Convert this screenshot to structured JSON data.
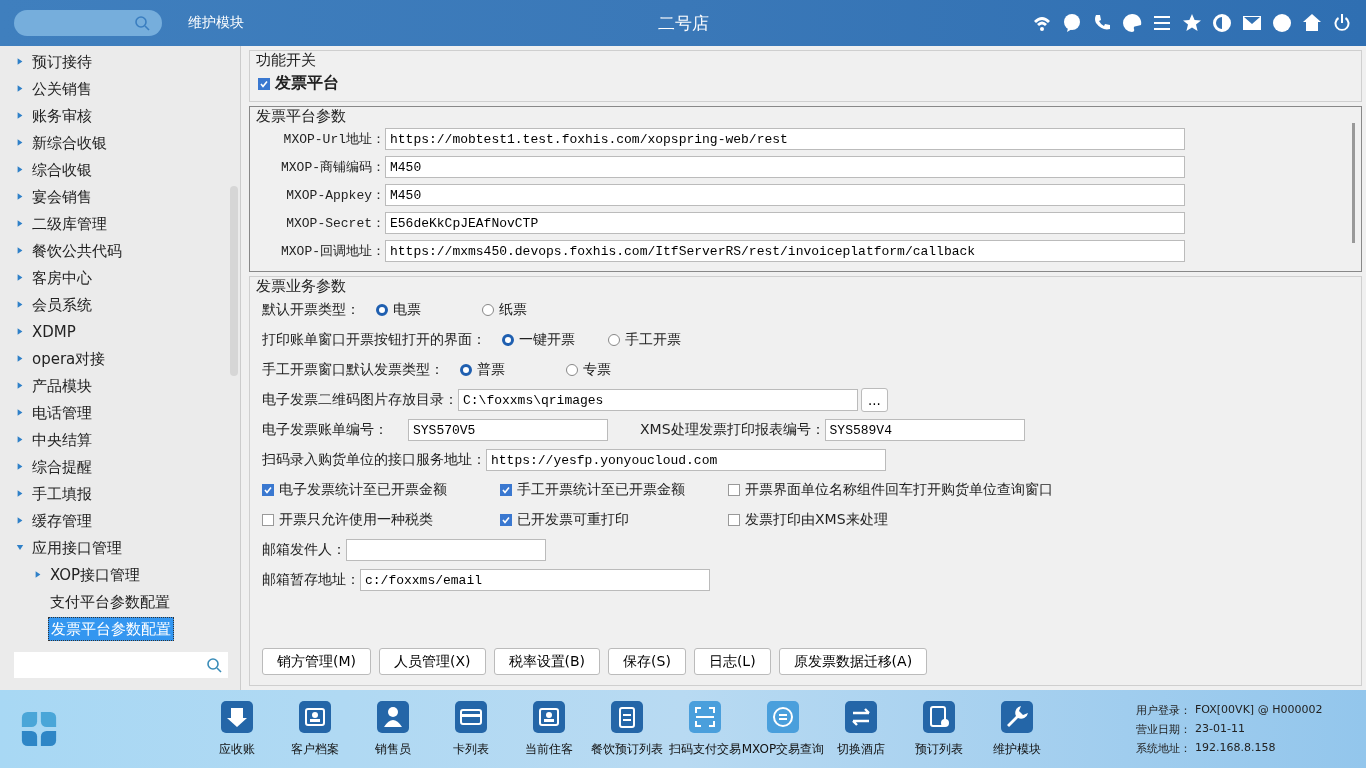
{
  "header": {
    "module": "维护模块",
    "title": "二号店"
  },
  "sidebar": {
    "items": [
      {
        "label": "预订接待",
        "kind": "folder",
        "expanded": false,
        "selected": false
      },
      {
        "label": "公关销售",
        "kind": "folder",
        "expanded": false,
        "selected": false
      },
      {
        "label": "账务审核",
        "kind": "folder",
        "expanded": false,
        "selected": false
      },
      {
        "label": "新综合收银",
        "kind": "folder",
        "expanded": false,
        "selected": false
      },
      {
        "label": "综合收银",
        "kind": "folder",
        "expanded": false,
        "selected": false
      },
      {
        "label": "宴会销售",
        "kind": "folder",
        "expanded": false,
        "selected": false
      },
      {
        "label": "二级库管理",
        "kind": "folder",
        "expanded": false,
        "selected": false
      },
      {
        "label": "餐饮公共代码",
        "kind": "folder",
        "expanded": false,
        "selected": false
      },
      {
        "label": "客房中心",
        "kind": "folder",
        "expanded": false,
        "selected": false
      },
      {
        "label": "会员系统",
        "kind": "folder",
        "expanded": false,
        "selected": false
      },
      {
        "label": "XDMP",
        "kind": "folder",
        "expanded": false,
        "selected": false
      },
      {
        "label": "opera对接",
        "kind": "folder",
        "expanded": false,
        "selected": false
      },
      {
        "label": "产品模块",
        "kind": "folder",
        "expanded": false,
        "selected": false
      },
      {
        "label": "电话管理",
        "kind": "folder",
        "expanded": false,
        "selected": false
      },
      {
        "label": "中央结算",
        "kind": "folder",
        "expanded": false,
        "selected": false
      },
      {
        "label": "综合提醒",
        "kind": "folder",
        "expanded": false,
        "selected": false
      },
      {
        "label": "手工填报",
        "kind": "folder",
        "expanded": false,
        "selected": false
      },
      {
        "label": "缓存管理",
        "kind": "folder",
        "expanded": false,
        "selected": false
      },
      {
        "label": "应用接口管理",
        "kind": "folder",
        "expanded": true,
        "selected": false,
        "children": [
          {
            "label": "XOP接口管理",
            "kind": "folder",
            "expanded": false,
            "selected": false
          },
          {
            "label": "支付平台参数配置",
            "kind": "leaf",
            "selected": false
          },
          {
            "label": "发票平台参数配置",
            "kind": "leaf",
            "selected": true
          }
        ]
      }
    ]
  },
  "switches": {
    "title": "功能开关",
    "items": [
      {
        "label": "发票平台",
        "checked": true
      }
    ]
  },
  "platform_params": {
    "title": "发票平台参数",
    "fields": [
      {
        "label": "MXOP-Url地址：",
        "value": "https://mobtest1.test.foxhis.com/xopspring-web/rest"
      },
      {
        "label": "MXOP-商铺编码：",
        "value": "M450"
      },
      {
        "label": "MXOP-Appkey：",
        "value": "M450"
      },
      {
        "label": "MXOP-Secret：",
        "value": "E56deKkCpJEAfNovCTP"
      },
      {
        "label": "MXOP-回调地址：",
        "value": "https://mxms450.devops.foxhis.com/ItfServerRS/rest/invoiceplatform/callback"
      }
    ]
  },
  "business_params": {
    "title": "发票业务参数",
    "radio_groups": [
      {
        "label": "默认开票类型：",
        "options": [
          {
            "label": "电票",
            "selected": true
          },
          {
            "label": "纸票",
            "selected": false
          }
        ]
      },
      {
        "label": "打印账单窗口开票按钮打开的界面：",
        "options": [
          {
            "label": "一键开票",
            "selected": true
          },
          {
            "label": "手工开票",
            "selected": false
          }
        ]
      },
      {
        "label": "手工开票窗口默认发票类型：",
        "options": [
          {
            "label": "普票",
            "selected": true
          },
          {
            "label": "专票",
            "selected": false
          }
        ]
      }
    ],
    "qr_dir": {
      "label": "电子发票二维码图片存放目录：",
      "value": "C:\\foxxms\\qrimages",
      "button": "..."
    },
    "bill_no": {
      "label": "电子发票账单编号：",
      "value": "SYS570V5"
    },
    "report_no": {
      "label": "XMS处理发票打印报表编号：",
      "value": "SYS589V4"
    },
    "scan_url": {
      "label": "扫码录入购货单位的接口服务地址：",
      "value": "https://yesfp.yonyoucloud.com"
    },
    "checkbox_rows": [
      [
        {
          "label": "电子发票统计至已开票金额",
          "checked": true
        },
        {
          "label": "手工开票统计至已开票金额",
          "checked": true
        },
        {
          "label": "开票界面单位名称组件回车打开购货单位查询窗口",
          "checked": false
        }
      ],
      [
        {
          "label": "开票只允许使用一种税类",
          "checked": false
        },
        {
          "label": "已开发票可重打印",
          "checked": true
        },
        {
          "label": "发票打印由XMS来处理",
          "checked": false
        }
      ]
    ],
    "email_sender": {
      "label": "邮箱发件人："
    },
    "email_path": {
      "label": "邮箱暂存地址：",
      "value": "c:/foxxms/email"
    },
    "buttons": [
      "销方管理(M)",
      "人员管理(X)",
      "税率设置(B)",
      "保存(S)",
      "日志(L)",
      "原发票数据迁移(A)"
    ]
  },
  "dock": {
    "items": [
      "应收账",
      "客户档案",
      "销售员",
      "卡列表",
      "当前住客",
      "餐饮预订列表",
      "扫码支付交易",
      "MXOP交易查询",
      "切换酒店",
      "预订列表",
      "维护模块"
    ]
  },
  "status": [
    {
      "label": "用户登录：",
      "value": "FOX[00VK] @ H000002"
    },
    {
      "label": "营业日期：",
      "value": "23-01-11"
    },
    {
      "label": "系统地址：",
      "value": "192.168.8.158"
    }
  ]
}
